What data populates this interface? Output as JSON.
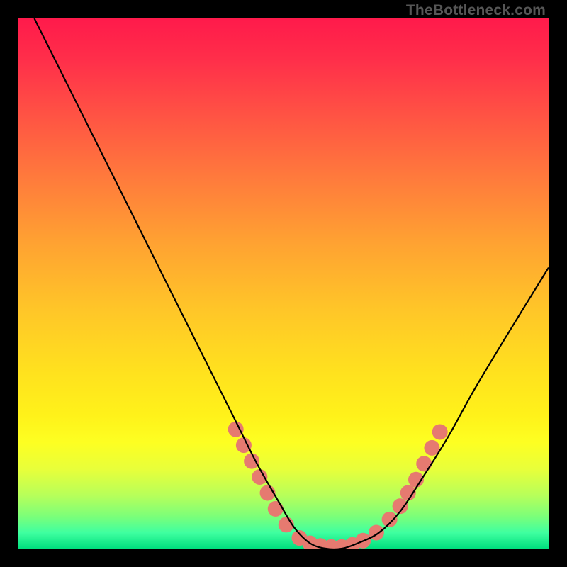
{
  "watermark": "TheBottleneck.com",
  "chart_data": {
    "type": "line",
    "title": "",
    "xlabel": "",
    "ylabel": "",
    "xlim": [
      0,
      100
    ],
    "ylim": [
      0,
      100
    ],
    "grid": false,
    "series": [
      {
        "name": "bottleneck-curve",
        "x": [
          3,
          8,
          12,
          18,
          24,
          30,
          36,
          41,
          45,
          49,
          52,
          55,
          58,
          61,
          64,
          68,
          72,
          76,
          81,
          86,
          92,
          100
        ],
        "y": [
          100,
          90,
          82,
          70,
          58,
          46,
          34,
          24,
          16,
          9,
          4,
          1,
          0,
          0,
          1,
          3,
          7,
          13,
          21,
          30,
          40,
          53
        ],
        "color": "#000000"
      }
    ],
    "highlight_points": {
      "name": "marker-dots",
      "color": "#e67a70",
      "points": [
        {
          "x": 41.0,
          "y": 22.5
        },
        {
          "x": 42.5,
          "y": 19.5
        },
        {
          "x": 44.0,
          "y": 16.5
        },
        {
          "x": 45.5,
          "y": 13.5
        },
        {
          "x": 47.0,
          "y": 10.5
        },
        {
          "x": 48.5,
          "y": 7.5
        },
        {
          "x": 50.5,
          "y": 4.5
        },
        {
          "x": 53.0,
          "y": 2.0
        },
        {
          "x": 55.0,
          "y": 1.0
        },
        {
          "x": 57.0,
          "y": 0.5
        },
        {
          "x": 59.0,
          "y": 0.3
        },
        {
          "x": 61.0,
          "y": 0.3
        },
        {
          "x": 63.0,
          "y": 0.7
        },
        {
          "x": 65.0,
          "y": 1.5
        },
        {
          "x": 67.5,
          "y": 3.0
        },
        {
          "x": 70.0,
          "y": 5.5
        },
        {
          "x": 72.0,
          "y": 8.0
        },
        {
          "x": 73.5,
          "y": 10.5
        },
        {
          "x": 75.0,
          "y": 13.0
        },
        {
          "x": 76.5,
          "y": 16.0
        },
        {
          "x": 78.0,
          "y": 19.0
        },
        {
          "x": 79.5,
          "y": 22.0
        }
      ]
    },
    "gradient": {
      "stops": [
        {
          "offset": 0.0,
          "color": "#ff1a4b"
        },
        {
          "offset": 0.08,
          "color": "#ff2f4a"
        },
        {
          "offset": 0.18,
          "color": "#ff5244"
        },
        {
          "offset": 0.3,
          "color": "#ff7a3c"
        },
        {
          "offset": 0.42,
          "color": "#ffa132"
        },
        {
          "offset": 0.55,
          "color": "#ffc628"
        },
        {
          "offset": 0.67,
          "color": "#ffe21e"
        },
        {
          "offset": 0.75,
          "color": "#fff21a"
        },
        {
          "offset": 0.8,
          "color": "#fdff22"
        },
        {
          "offset": 0.85,
          "color": "#e8ff3a"
        },
        {
          "offset": 0.9,
          "color": "#b7ff5a"
        },
        {
          "offset": 0.94,
          "color": "#7aff7a"
        },
        {
          "offset": 0.97,
          "color": "#3fffa0"
        },
        {
          "offset": 1.0,
          "color": "#00e07e"
        }
      ]
    }
  }
}
